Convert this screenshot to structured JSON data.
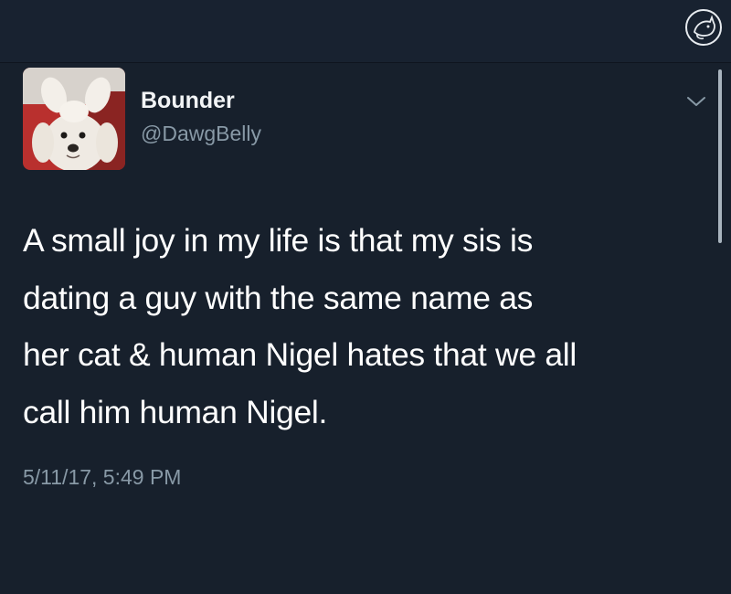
{
  "watermark": {
    "icon": "cat-logo-icon"
  },
  "author": {
    "display_name": "Bounder",
    "handle": "@DawgBelly",
    "avatar_icon": "dog-avatar"
  },
  "tweet": {
    "lines": [
      "A small joy in my life is that my sis is",
      "dating a guy with the same name as",
      "her cat & human Nigel hates that we all",
      "call him human Nigel."
    ],
    "timestamp": "5/11/17, 5:49 PM"
  },
  "menu": {
    "icon": "chevron-down-icon"
  },
  "colors": {
    "background": "#17202c",
    "text": "#ffffff",
    "secondary_text": "#8899a6"
  }
}
